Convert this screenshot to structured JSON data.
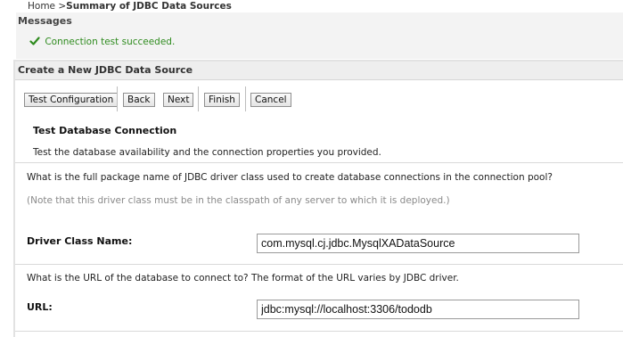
{
  "breadcrumb": {
    "home": "Home",
    "separator": " >",
    "current": "Summary of JDBC Data Sources"
  },
  "messages": {
    "title": "Messages",
    "items": [
      {
        "icon": "check-icon",
        "text": "Connection test succeeded.",
        "color": "#2e8b1e"
      }
    ]
  },
  "wizard": {
    "title": "Create a New JDBC Data Source",
    "buttons": {
      "test_configuration": "Test Configuration",
      "back": "Back",
      "next": "Next",
      "finish": "Finish",
      "cancel": "Cancel"
    },
    "section_title": "Test Database Connection",
    "section_description": "Test the database availability and the connection properties you provided.",
    "driver_question": "What is the full package name of JDBC driver class used to create database connections in the connection pool?",
    "driver_note": "(Note that this driver class must be in the classpath of any server to which it is deployed.)",
    "driver_label": "Driver Class Name:",
    "driver_value": "com.mysql.cj.jdbc.MysqlXADataSource",
    "url_question": "What is the URL of the database to connect to? The format of the URL varies by JDBC driver.",
    "url_label": "URL:",
    "url_value": "jdbc:mysql://localhost:3306/tododb"
  }
}
